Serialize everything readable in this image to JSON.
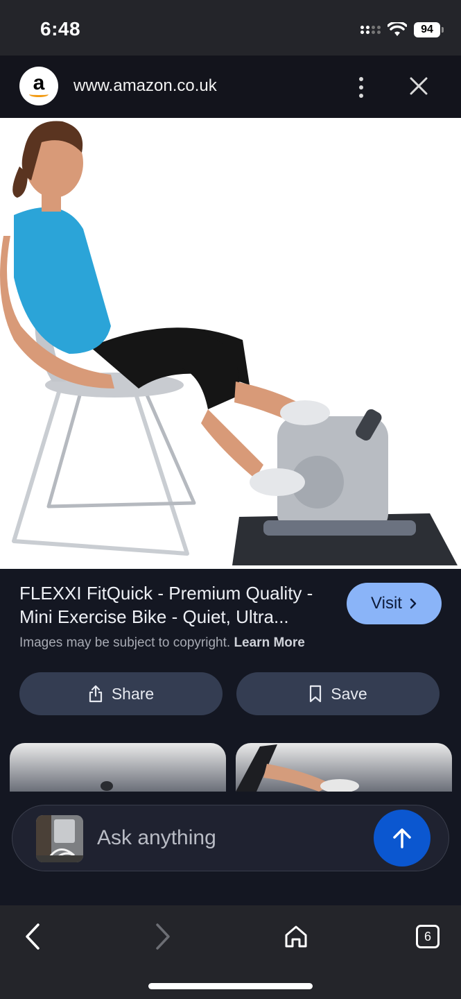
{
  "status_bar": {
    "time": "6:48",
    "battery": "94",
    "icons": [
      "cellular-signal-icon",
      "wifi-icon",
      "battery-icon"
    ]
  },
  "browser": {
    "site_logo_letter": "a",
    "url": "www.amazon.co.uk",
    "icons": [
      "more-vert-icon",
      "close-icon"
    ]
  },
  "product": {
    "image_alt": "Woman seated on a chair pedalling a mini exercise bike",
    "title": "FLEXXI FitQuick - Premium Quality - Mini Exercise Bike - Quiet, Ultra...",
    "visit_label": "Visit",
    "copyright_text": "Images may be subject to copyright.",
    "learn_more": "Learn More"
  },
  "actions": {
    "share_label": "Share",
    "save_label": "Save"
  },
  "ask_bar": {
    "placeholder": "Ask anything"
  },
  "bottom_nav": {
    "tab_count": "6",
    "icons": [
      "back-icon",
      "forward-icon",
      "home-icon",
      "tabs-icon"
    ]
  },
  "colors": {
    "accent_blue": "#8ab4f8",
    "send_button": "#0b57d0",
    "background": "#141722",
    "button_bg": "#343d52"
  }
}
